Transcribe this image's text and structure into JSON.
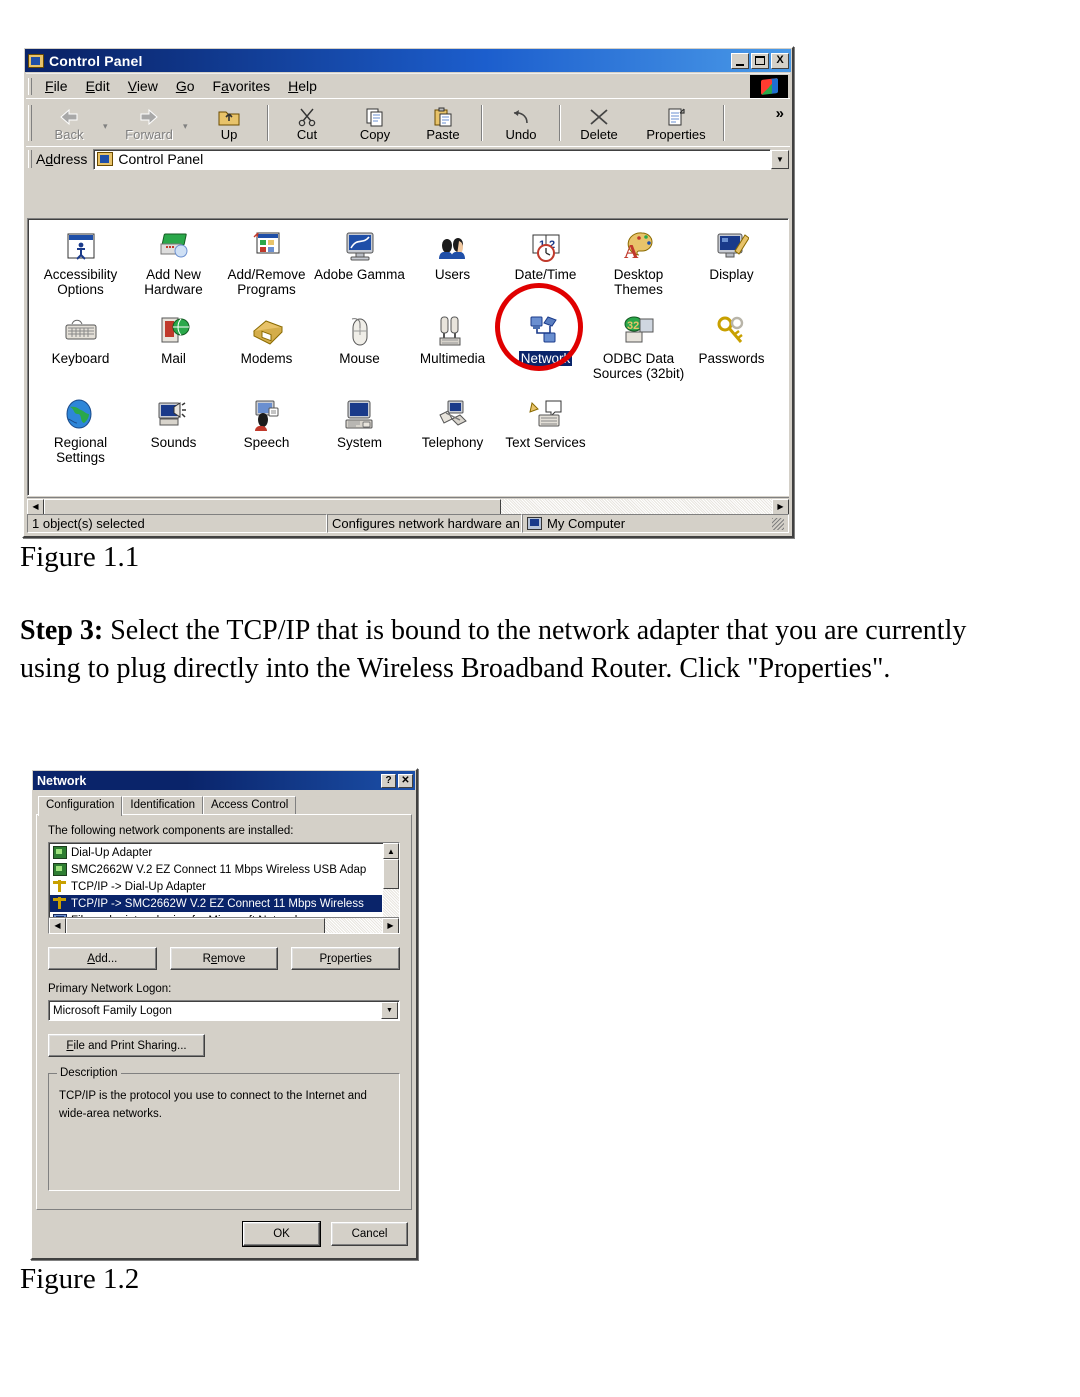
{
  "document": {
    "figure1_caption": "Figure 1.1",
    "figure2_caption": "Figure 1.2",
    "step": {
      "label": "Step 3:",
      "text": " Select the TCP/IP that is bound to the network adapter that you are currently using to plug directly into the Wireless Broadband Router. Click \"Properties\"."
    }
  },
  "control_panel": {
    "title": "Control Panel",
    "window_buttons": {
      "minimize": "_",
      "maximize": "□",
      "close": "X"
    },
    "menus": [
      "File",
      "Edit",
      "View",
      "Go",
      "Favorites",
      "Help"
    ],
    "toolbar": {
      "back": "Back",
      "forward": "Forward",
      "up": "Up",
      "cut": "Cut",
      "copy": "Copy",
      "paste": "Paste",
      "undo": "Undo",
      "delete": "Delete",
      "properties": "Properties",
      "overflow": "»"
    },
    "address": {
      "label": "Address",
      "value": "Control Panel"
    },
    "icons": [
      {
        "name": "Accessibility\nOptions",
        "icon": "accessibility-icon",
        "selected": false
      },
      {
        "name": "Add New\nHardware",
        "icon": "add-new-hardware-icon",
        "selected": false
      },
      {
        "name": "Add/Remove\nPrograms",
        "icon": "add-remove-programs-icon",
        "selected": false
      },
      {
        "name": "Adobe Gamma",
        "icon": "adobe-gamma-icon",
        "selected": false
      },
      {
        "name": "Users",
        "icon": "users-icon",
        "selected": false
      },
      {
        "name": "Date/Time",
        "icon": "date-time-icon",
        "selected": false
      },
      {
        "name": "Desktop\nThemes",
        "icon": "desktop-themes-icon",
        "selected": false
      },
      {
        "name": "Display",
        "icon": "display-icon",
        "selected": false
      },
      {
        "name": "Keyboard",
        "icon": "keyboard-icon",
        "selected": false
      },
      {
        "name": "Mail",
        "icon": "mail-icon",
        "selected": false
      },
      {
        "name": "Modems",
        "icon": "modems-icon",
        "selected": false
      },
      {
        "name": "Mouse",
        "icon": "mouse-icon",
        "selected": false
      },
      {
        "name": "Multimedia",
        "icon": "multimedia-icon",
        "selected": false
      },
      {
        "name": "Network",
        "icon": "network-icon",
        "selected": true
      },
      {
        "name": "ODBC Data\nSources (32bit)",
        "icon": "odbc-data-sources-icon",
        "selected": false
      },
      {
        "name": "Passwords",
        "icon": "passwords-icon",
        "selected": false
      },
      {
        "name": "Regional\nSettings",
        "icon": "regional-settings-icon",
        "selected": false
      },
      {
        "name": "Sounds",
        "icon": "sounds-icon",
        "selected": false
      },
      {
        "name": "Speech",
        "icon": "speech-icon",
        "selected": false
      },
      {
        "name": "System",
        "icon": "system-icon",
        "selected": false
      },
      {
        "name": "Telephony",
        "icon": "telephony-icon",
        "selected": false
      },
      {
        "name": "Text Services",
        "icon": "text-services-icon",
        "selected": false
      }
    ],
    "status": {
      "selection": "1 object(s) selected",
      "description": "Configures network hardware an",
      "zone": "My Computer"
    },
    "annotation_color": "#e00000"
  },
  "network_dialog": {
    "title": "Network",
    "help_button": "?",
    "close_button": "✕",
    "tabs": [
      {
        "label": "Configuration",
        "active": true
      },
      {
        "label": "Identification",
        "active": false
      },
      {
        "label": "Access Control",
        "active": false
      }
    ],
    "components_label": "The following network components are installed:",
    "components": [
      {
        "label": "Dial-Up Adapter",
        "icon": "network-adapter-icon",
        "selected": false
      },
      {
        "label": "SMC2662W V.2 EZ Connect 11 Mbps Wireless USB Adap",
        "icon": "network-adapter-icon",
        "selected": false
      },
      {
        "label": "TCP/IP -> Dial-Up Adapter",
        "icon": "protocol-icon",
        "selected": false
      },
      {
        "label": "TCP/IP -> SMC2662W V.2 EZ Connect 11 Mbps Wireless",
        "icon": "protocol-icon",
        "selected": true
      },
      {
        "label": "File and printer sharing for Microsoft Networks",
        "icon": "file-sharing-icon",
        "selected": false
      }
    ],
    "buttons": {
      "add": "Add...",
      "remove": "Remove",
      "properties": "Properties"
    },
    "primary_logon_label": "Primary Network Logon:",
    "primary_logon_value": "Microsoft Family Logon",
    "file_print_sharing_button": "File and Print Sharing...",
    "description_group_title": "Description",
    "description_text": "TCP/IP is the protocol you use to connect to the Internet and wide-area networks.",
    "ok_button": "OK",
    "cancel_button": "Cancel"
  }
}
